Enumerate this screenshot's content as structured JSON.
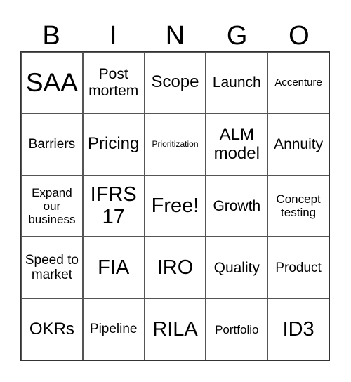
{
  "header": [
    "B",
    "I",
    "N",
    "G",
    "O"
  ],
  "cells": [
    [
      "SAA",
      "Post mortem",
      "Scope",
      "Launch",
      "Accenture"
    ],
    [
      "Barriers",
      "Pricing",
      "Prioritization",
      "ALM model",
      "Annuity"
    ],
    [
      "Expand our business",
      "IFRS 17",
      "Free!",
      "Growth",
      "Concept testing"
    ],
    [
      "Speed to market",
      "FIA",
      "IRO",
      "Quality",
      "Product"
    ],
    [
      "OKRs",
      "Pipeline",
      "RILA",
      "Portfolio",
      "ID3"
    ]
  ]
}
